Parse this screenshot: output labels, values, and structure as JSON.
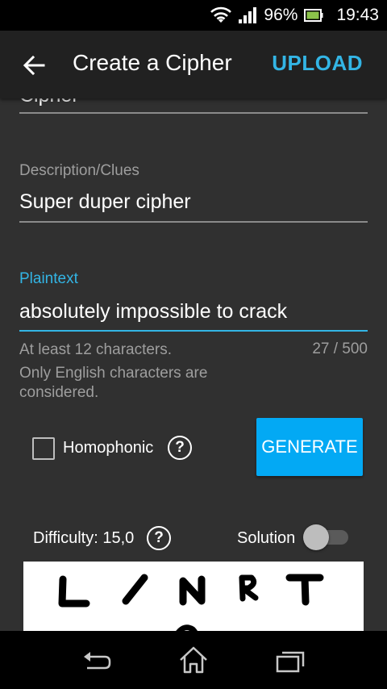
{
  "status_bar": {
    "battery": "96%",
    "time": "19:43",
    "icons": [
      "wifi-icon",
      "signal-icon",
      "battery-icon"
    ]
  },
  "app_bar": {
    "title": "Create a Cipher",
    "action": "UPLOAD",
    "back_icon": "arrow-back-icon"
  },
  "form": {
    "name_value": "Cipher",
    "description_label": "Description/Clues",
    "description_value": "Super duper cipher",
    "plaintext_label": "Plaintext",
    "plaintext_value": "absolutely impossible to crack",
    "helper_text": "At least 12 characters.",
    "counter": "27 / 500",
    "note": "Only English characters are considered."
  },
  "options": {
    "homophonic_label": "Homophonic",
    "homophonic_checked": false,
    "help_glyph": "?",
    "generate_label": "GENERATE",
    "difficulty_label": "Difficulty: 15,0",
    "solution_label": "Solution",
    "solution_on": false
  },
  "colors": {
    "accent": "#33b5e5",
    "button": "#03a9f4",
    "background": "#303030",
    "appbar": "#212121"
  },
  "nav_bar": {
    "icons": [
      "back-nav-icon",
      "home-nav-icon",
      "recents-nav-icon"
    ]
  }
}
